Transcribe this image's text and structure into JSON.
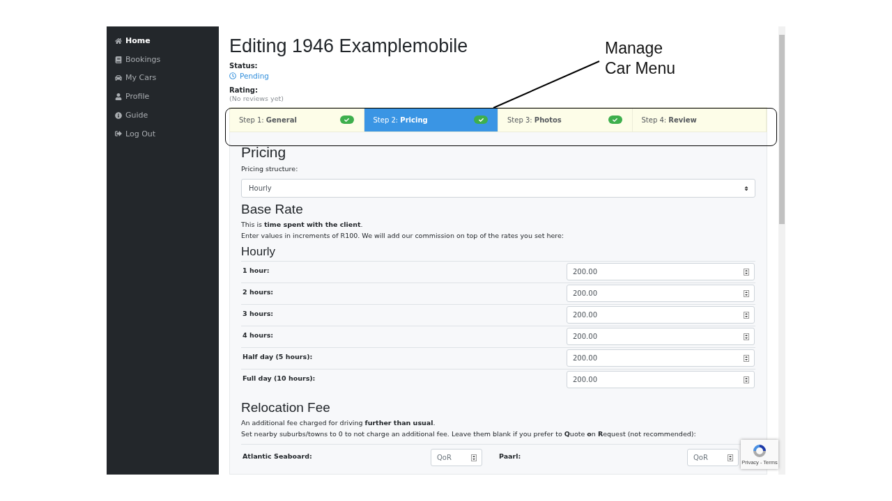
{
  "sidebar": {
    "items": [
      {
        "label": "Home",
        "selected": true
      },
      {
        "label": "Bookings",
        "selected": false
      },
      {
        "label": "My Cars",
        "selected": false
      },
      {
        "label": "Profile",
        "selected": false
      },
      {
        "label": "Guide",
        "selected": false
      },
      {
        "label": "Log Out",
        "selected": false
      }
    ]
  },
  "title": "Editing 1946 Examplemobile",
  "status": {
    "label": "Status:",
    "value": "Pending"
  },
  "rating": {
    "label": "Rating:",
    "value": "(No reviews yet)"
  },
  "steps": [
    {
      "label": "Step 1: **General**",
      "selected": false,
      "complete": true
    },
    {
      "label": "Step 2: **Pricing**",
      "selected": true,
      "complete": true
    },
    {
      "label": "Step 3: **Photos**",
      "selected": false,
      "complete": true
    },
    {
      "label": "Step 4: **Review**",
      "selected": false,
      "complete": false
    }
  ],
  "pricing": {
    "heading": "Pricing",
    "structure_label": "Pricing structure:",
    "structure_value": "Hourly"
  },
  "base_rate": {
    "heading": "Base Rate",
    "lines": [
      "This is **time spent with the client**.",
      "Enter values in increments of R100. We will add our commission on top of the rates you set here:"
    ]
  },
  "hourly": {
    "heading": "Hourly",
    "rows": [
      {
        "label": "1 hour:",
        "value": "200.00"
      },
      {
        "label": "2 hours:",
        "value": "200.00"
      },
      {
        "label": "3 hours:",
        "value": "200.00"
      },
      {
        "label": "4 hours:",
        "value": "200.00"
      },
      {
        "label": "Half day (5 hours):",
        "value": "200.00"
      },
      {
        "label": "Full day (10 hours):",
        "value": "200.00"
      }
    ]
  },
  "relocation": {
    "heading": "Relocation Fee",
    "lines": [
      "An additional fee charged for driving **further than usual**.",
      "Set nearby suburbs/towns to 0 to not charge an additional fee. Leave them blank if you prefer to **Q**uote **o**n **R**equest (not recommended):"
    ],
    "fields": [
      {
        "label": "Atlantic Seaboard:",
        "placeholder": "QoR"
      },
      {
        "label": "Paarl:",
        "placeholder": "QoR"
      }
    ]
  },
  "recaptcha": {
    "text": "Privacy - Terms"
  },
  "annotation": {
    "lines": [
      "Manage",
      "Car Menu"
    ]
  }
}
